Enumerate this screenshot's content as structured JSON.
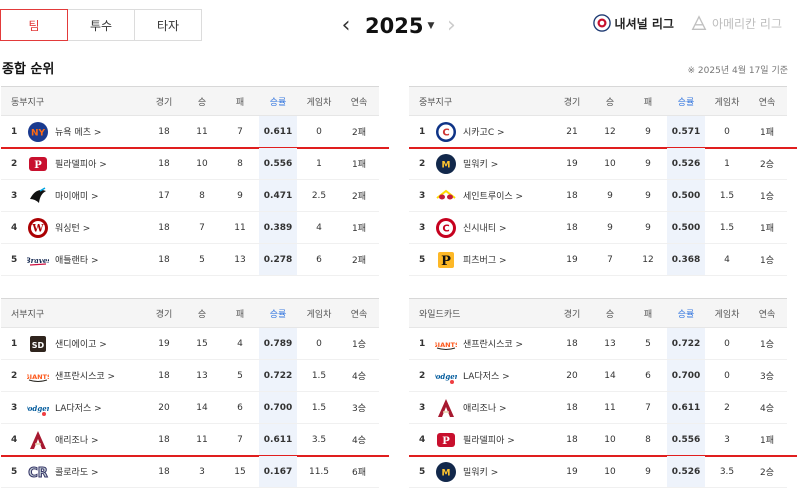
{
  "tabs": [
    {
      "label": "팀",
      "active": true
    },
    {
      "label": "투수",
      "active": false
    },
    {
      "label": "타자",
      "active": false
    }
  ],
  "year": {
    "prev": "‹",
    "value": "2025",
    "caret": "▼",
    "next": "›"
  },
  "leagues": [
    {
      "label": "내셔널 리그",
      "active": true,
      "color": "#1f3b73"
    },
    {
      "label": "아메리칸 리그",
      "active": false,
      "color": "#c0c0c0"
    }
  ],
  "section_title": "종합 순위",
  "as_of": "※ 2025년 4월 17일 기준",
  "columns": {
    "games": "경기",
    "wins": "승",
    "losses": "패",
    "pct": "승률",
    "gb": "게임차",
    "streak": "연속"
  },
  "divisions": [
    {
      "name": "동부지구",
      "rows": [
        {
          "rank": "1",
          "team": "뉴욕 메츠 >",
          "logo": "mets-logo",
          "color": "#1a3a8f",
          "accent": "#ff6a13",
          "g": "18",
          "w": "11",
          "l": "7",
          "pct": "0.611",
          "gb": "0",
          "strk": "2패",
          "underline": true
        },
        {
          "rank": "2",
          "team": "필라델피아 >",
          "logo": "phillies-logo",
          "color": "#c8102e",
          "accent": "#1b3b85",
          "g": "18",
          "w": "10",
          "l": "8",
          "pct": "0.556",
          "gb": "1",
          "strk": "1패"
        },
        {
          "rank": "3",
          "team": "마이애미 >",
          "logo": "marlins-logo",
          "color": "#111111",
          "accent": "#00a3e0",
          "g": "17",
          "w": "8",
          "l": "9",
          "pct": "0.471",
          "gb": "2.5",
          "strk": "2패"
        },
        {
          "rank": "4",
          "team": "워싱턴 >",
          "logo": "nationals-logo",
          "color": "#ab0003",
          "accent": "#14225a",
          "g": "18",
          "w": "7",
          "l": "11",
          "pct": "0.389",
          "gb": "4",
          "strk": "1패"
        },
        {
          "rank": "5",
          "team": "애틀랜타 >",
          "logo": "braves-logo",
          "color": "#13274f",
          "accent": "#ce1141",
          "g": "18",
          "w": "5",
          "l": "13",
          "pct": "0.278",
          "gb": "6",
          "strk": "2패"
        }
      ]
    },
    {
      "name": "중부지구",
      "rows": [
        {
          "rank": "1",
          "team": "시카고C >",
          "logo": "cubs-logo",
          "color": "#0e3386",
          "accent": "#cc3433",
          "g": "21",
          "w": "12",
          "l": "9",
          "pct": "0.571",
          "gb": "0",
          "strk": "1패",
          "underline": true
        },
        {
          "rank": "2",
          "team": "밀워키 >",
          "logo": "brewers-logo",
          "color": "#12284b",
          "accent": "#ffc52f",
          "g": "19",
          "w": "10",
          "l": "9",
          "pct": "0.526",
          "gb": "1",
          "strk": "2승"
        },
        {
          "rank": "3",
          "team": "세인트루이스 >",
          "logo": "cardinals-logo",
          "color": "#c41e3a",
          "accent": "#fedb00",
          "g": "18",
          "w": "9",
          "l": "9",
          "pct": "0.500",
          "gb": "1.5",
          "strk": "1승"
        },
        {
          "rank": "3",
          "team": "신시내티 >",
          "logo": "reds-logo",
          "color": "#c6011f",
          "accent": "#ffffff",
          "g": "18",
          "w": "9",
          "l": "9",
          "pct": "0.500",
          "gb": "1.5",
          "strk": "1패"
        },
        {
          "rank": "5",
          "team": "피츠버그 >",
          "logo": "pirates-logo",
          "color": "#111111",
          "accent": "#fdb827",
          "g": "19",
          "w": "7",
          "l": "12",
          "pct": "0.368",
          "gb": "4",
          "strk": "1승"
        }
      ]
    },
    {
      "name": "서부지구",
      "rows": [
        {
          "rank": "1",
          "team": "샌디에이고 >",
          "logo": "padres-logo",
          "color": "#2f241d",
          "accent": "#ffc425",
          "g": "19",
          "w": "15",
          "l": "4",
          "pct": "0.789",
          "gb": "0",
          "strk": "1승"
        },
        {
          "rank": "2",
          "team": "샌프란시스코 >",
          "logo": "giants-logo",
          "color": "#fd5a1e",
          "accent": "#27251f",
          "g": "18",
          "w": "13",
          "l": "5",
          "pct": "0.722",
          "gb": "1.5",
          "strk": "4승"
        },
        {
          "rank": "3",
          "team": "LA다저스 >",
          "logo": "dodgers-logo",
          "color": "#005a9c",
          "accent": "#ef3e42",
          "g": "20",
          "w": "14",
          "l": "6",
          "pct": "0.700",
          "gb": "1.5",
          "strk": "3승"
        },
        {
          "rank": "4",
          "team": "애리조나 >",
          "logo": "dbacks-logo",
          "color": "#a71930",
          "accent": "#e3d4ad",
          "g": "18",
          "w": "11",
          "l": "7",
          "pct": "0.611",
          "gb": "3.5",
          "strk": "4승",
          "underline": true
        },
        {
          "rank": "5",
          "team": "콜로라도 >",
          "logo": "rockies-logo",
          "color": "#333366",
          "accent": "#c4ced4",
          "g": "18",
          "w": "3",
          "l": "15",
          "pct": "0.167",
          "gb": "11.5",
          "strk": "6패"
        }
      ]
    },
    {
      "name": "와일드카드",
      "rows": [
        {
          "rank": "1",
          "team": "샌프란시스코 >",
          "logo": "giants-logo",
          "color": "#fd5a1e",
          "accent": "#27251f",
          "g": "18",
          "w": "13",
          "l": "5",
          "pct": "0.722",
          "gb": "0",
          "strk": "1승"
        },
        {
          "rank": "2",
          "team": "LA다저스 >",
          "logo": "dodgers-logo",
          "color": "#005a9c",
          "accent": "#ef3e42",
          "g": "20",
          "w": "14",
          "l": "6",
          "pct": "0.700",
          "gb": "0",
          "strk": "3승"
        },
        {
          "rank": "3",
          "team": "애리조나 >",
          "logo": "dbacks-logo",
          "color": "#a71930",
          "accent": "#e3d4ad",
          "g": "18",
          "w": "11",
          "l": "7",
          "pct": "0.611",
          "gb": "2",
          "strk": "4승"
        },
        {
          "rank": "4",
          "team": "필라델피아 >",
          "logo": "phillies-logo",
          "color": "#c8102e",
          "accent": "#1b3b85",
          "g": "18",
          "w": "10",
          "l": "8",
          "pct": "0.556",
          "gb": "3",
          "strk": "1패",
          "underline": true
        },
        {
          "rank": "5",
          "team": "밀워키 >",
          "logo": "brewers-logo",
          "color": "#12284b",
          "accent": "#ffc52f",
          "g": "19",
          "w": "10",
          "l": "9",
          "pct": "0.526",
          "gb": "3.5",
          "strk": "2승"
        }
      ]
    }
  ],
  "colors": {
    "accent_red": "#e23a3a",
    "pct_blue": "#3b7be0",
    "underline_red": "#e01e1e"
  }
}
